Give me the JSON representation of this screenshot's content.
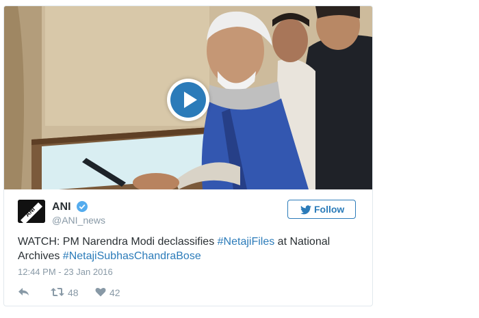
{
  "tweet": {
    "author_name": "ANI",
    "author_handle": "@ANI_news",
    "avatar_text": "ANI",
    "follow_label": "Follow",
    "text_prefix": "WATCH: PM Narendra Modi declassifies ",
    "hashtag_1": "#NetajiFiles",
    "text_middle": " at National Archives ",
    "hashtag_2": "#NetajiSubhasChandraBose",
    "timestamp": "12:44 PM - 23 Jan 2016",
    "retweets": "48",
    "likes": "42"
  },
  "icons": {
    "play": "play-icon",
    "verified": "verified-badge-icon",
    "follow": "twitter-bird-icon",
    "reply": "reply-icon",
    "retweet": "retweet-icon",
    "like": "heart-icon"
  },
  "colors": {
    "accent": "#2b7bb9",
    "text": "#292f33",
    "muted": "#8899a6",
    "border": "#e1e8ed",
    "play_button": "#2b7bb9"
  }
}
